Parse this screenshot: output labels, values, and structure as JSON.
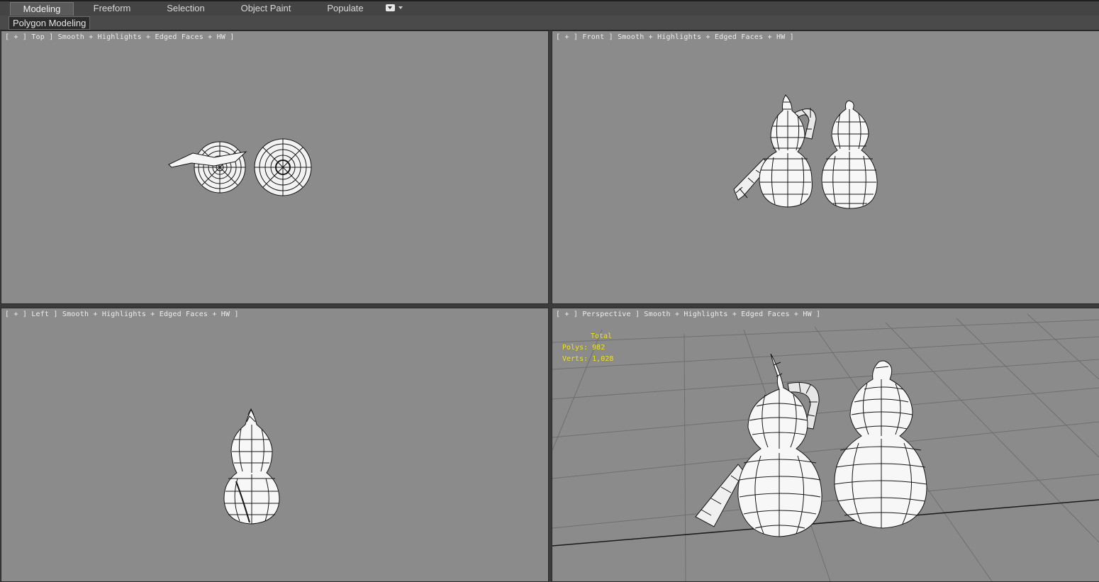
{
  "ribbon": {
    "tabs": [
      {
        "label": "Modeling",
        "active": true
      },
      {
        "label": "Freeform",
        "active": false
      },
      {
        "label": "Selection",
        "active": false
      },
      {
        "label": "Object Paint",
        "active": false
      },
      {
        "label": "Populate",
        "active": false
      }
    ],
    "dropdown_icon": "ribbon-options-icon",
    "panel_label": "Polygon Modeling"
  },
  "viewports": {
    "top": {
      "label": "[ + ] Top ] Smooth + Highlights + Edged Faces + HW ]"
    },
    "front": {
      "label": "[ + ] Front ] Smooth + Highlights + Edged Faces + HW ]"
    },
    "left": {
      "label": "[ + ] Left ] Smooth + Highlights + Edged Faces + HW ]"
    },
    "perspective": {
      "label": "[ + ] Perspective ] Smooth + Highlights + Edged Faces + HW ]",
      "stats": {
        "header": "Total",
        "polys_label": "Polys:",
        "polys_value": "982",
        "verts_label": "Verts:",
        "verts_value": "1,028"
      }
    }
  },
  "colors": {
    "viewport_bg": "#8b8b8b",
    "stats_text": "#f2e11a",
    "ui_dark": "#3b3b3b",
    "mesh_fill": "#f4f4f4",
    "wire": "#151515"
  }
}
